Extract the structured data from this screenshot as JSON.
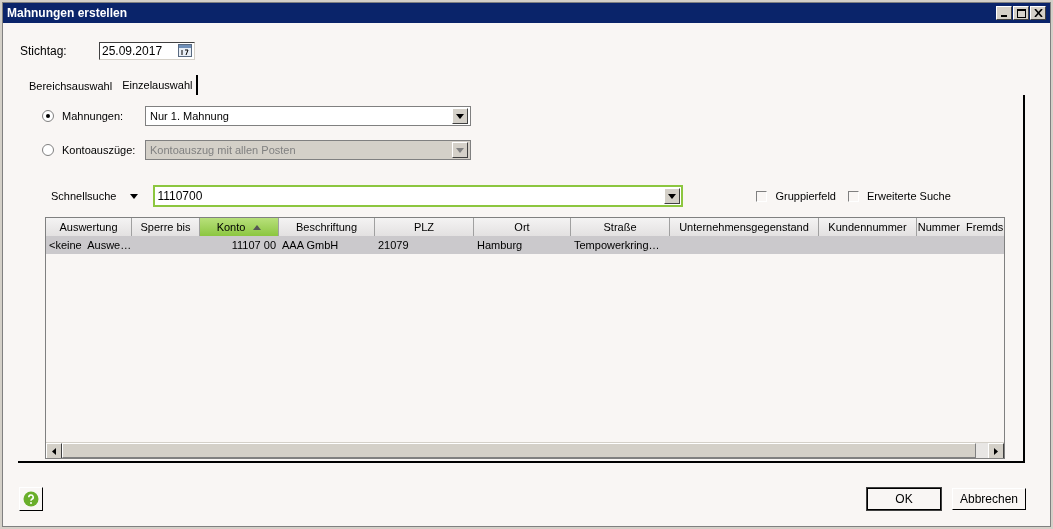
{
  "window": {
    "title": "Mahnungen erstellen"
  },
  "stichtag": {
    "label": "Stichtag:",
    "value": "25.09.2017"
  },
  "tabs": [
    {
      "label": "Bereichsauswahl",
      "selected": false
    },
    {
      "label": "Einzelauswahl",
      "selected": true
    }
  ],
  "options": [
    {
      "label": "Mahnungen:",
      "selected": true,
      "value": "Nur 1. Mahnung",
      "disabled": false
    },
    {
      "label": "Kontoauszüge:",
      "selected": false,
      "value": "Kontoauszug mit allen Posten",
      "disabled": true
    }
  ],
  "quick_search": {
    "label": "Schnellsuche",
    "value": "1110700"
  },
  "checkboxes": [
    {
      "label": "Gruppierfeld",
      "checked": false
    },
    {
      "label": "Erweiterte Suche",
      "checked": false
    }
  ],
  "table": {
    "columns": [
      {
        "label": "Auswertung",
        "sorted": false
      },
      {
        "label": "Sperre bis",
        "sorted": false
      },
      {
        "label": "Konto",
        "sorted": true
      },
      {
        "label": "Beschriftung",
        "sorted": false
      },
      {
        "label": "PLZ",
        "sorted": false
      },
      {
        "label": "Ort",
        "sorted": false
      },
      {
        "label": "Straße",
        "sorted": false
      },
      {
        "label": "Unternehmensgegenstand",
        "sorted": false
      },
      {
        "label": "Kundennummer",
        "sorted": false
      },
      {
        "label": "Nummer  Fremds",
        "sorted": false
      }
    ],
    "rows": [
      {
        "selected": true,
        "cells": [
          "<keine  Auswe…",
          "",
          "11107 00",
          "AAA GmbH",
          "21079",
          "Hamburg",
          "Tempowerkring…",
          "",
          "",
          ""
        ]
      }
    ]
  },
  "buttons": [
    {
      "label": "OK"
    },
    {
      "label": "Abbrechen"
    }
  ]
}
